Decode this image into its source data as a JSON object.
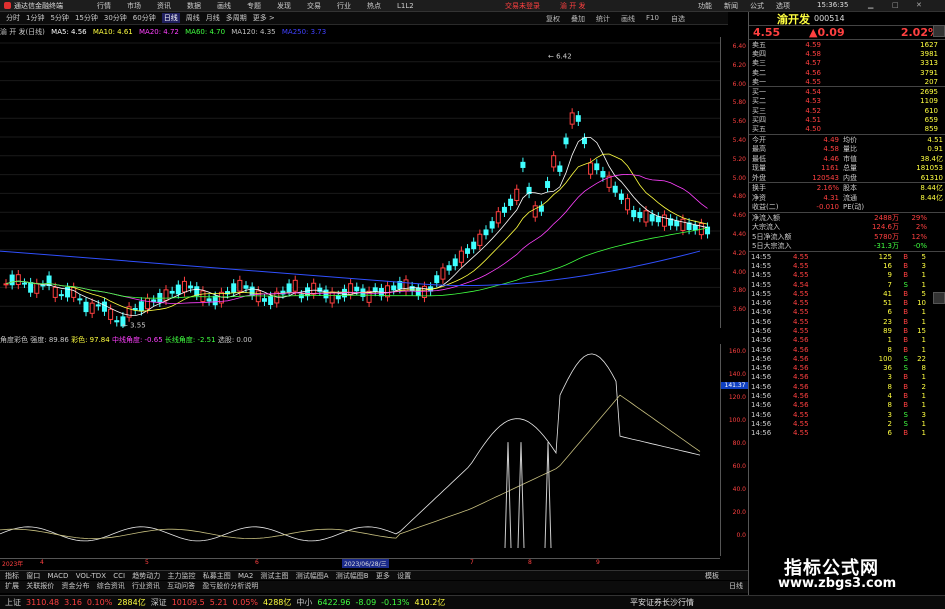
{
  "titlebar": {
    "app_name": "通达信金融终端",
    "menus": [
      "行情",
      "市场",
      "资讯",
      "数据",
      "画线",
      "专题",
      "发现",
      "交易",
      "行业",
      "热点",
      "L1L2"
    ],
    "trade_login": "交易未登录",
    "stock_name": "渝 开 发",
    "right_menus": [
      "功能",
      "新闻",
      "公式",
      "选项"
    ],
    "clock": "15:36:35"
  },
  "toolbar": {
    "periods": [
      "分时",
      "1分钟",
      "5分钟",
      "15分钟",
      "30分钟",
      "60分钟",
      "日线",
      "周线",
      "月线",
      "多周期",
      "更多 >"
    ],
    "active": "日线",
    "right_buttons": [
      "复权",
      "叠加",
      "统计",
      "画线",
      "F10",
      "自选"
    ]
  },
  "ma_legend": {
    "title": "渝 开 发(日线)",
    "items": [
      {
        "label": "MA5: 4.56",
        "color": "#ffffff"
      },
      {
        "label": "MA10: 4.61",
        "color": "#ffff40"
      },
      {
        "label": "MA20: 4.72",
        "color": "#ff40ff"
      },
      {
        "label": "MA60: 4.70",
        "color": "#40ff40"
      },
      {
        "label": "MA120: 4.35",
        "color": "#c0c0c0"
      },
      {
        "label": "MA250: 3.73",
        "color": "#4040ff"
      }
    ]
  },
  "main_chart": {
    "y_ticks": [
      "6.40",
      "6.20",
      "6.00",
      "5.80",
      "5.60",
      "5.40",
      "5.20",
      "5.00",
      "4.80",
      "4.60",
      "4.40",
      "4.20",
      "4.00",
      "3.80",
      "3.60"
    ],
    "high_label": "6.42",
    "low_label": "3.55"
  },
  "sub_chart": {
    "legend": [
      {
        "label": "角度彩色",
        "color": "#c8c8c8"
      },
      {
        "label": "强度: 89.86",
        "color": "#c8c8c8"
      },
      {
        "label": "彩色: 97.84",
        "color": "#ffff40"
      },
      {
        "label": "中线角度: -0.65",
        "color": "#ff40ff"
      },
      {
        "label": "长线角度: -2.51",
        "color": "#40ff40"
      },
      {
        "label": "选股: 0.00",
        "color": "#c8c8c8"
      }
    ],
    "y_ticks": [
      "160.0",
      "140.0",
      "120.0",
      "100.0",
      "80.0",
      "60.0",
      "40.0",
      "20.0",
      "0.0"
    ],
    "current_value": "141.37"
  },
  "date_axis": {
    "labels": [
      "2023年",
      "4",
      "5",
      "6",
      "7",
      "8",
      "9"
    ],
    "selected": "2023/06/28/三"
  },
  "bottom_tabs": [
    "指标",
    "窗口",
    "MACD",
    "VOL-TDX",
    "CCI",
    "趋势动力",
    "主力监控",
    "私募主图",
    "MA2",
    "测试主图",
    "测试幅图A",
    "测试幅图B",
    "更多",
    "设置"
  ],
  "bottom_tabs2": [
    "扩展",
    "关联报价",
    "资金分布",
    "综合资讯",
    "行业资讯",
    "互动问答",
    "盈亏股价分析说明"
  ],
  "bottom_tabs2_right": [
    "模板",
    "日线"
  ],
  "statusbar": {
    "items": [
      {
        "label": "上证",
        "color": "#c8c8c8"
      },
      {
        "label": "3110.48",
        "color": "#ff4040"
      },
      {
        "label": "3.16",
        "color": "#ff4040"
      },
      {
        "label": "0.10%",
        "color": "#ff4040"
      },
      {
        "label": "2884亿",
        "color": "#ffff40"
      },
      {
        "label": "深证",
        "color": "#c8c8c8"
      },
      {
        "label": "10109.5",
        "color": "#ff4040"
      },
      {
        "label": "5.21",
        "color": "#ff4040"
      },
      {
        "label": "0.05%",
        "color": "#ff4040"
      },
      {
        "label": "4288亿",
        "color": "#ffff40"
      },
      {
        "label": "中小",
        "color": "#c8c8c8"
      },
      {
        "label": "6422.96",
        "color": "#40ff40"
      },
      {
        "label": "-8.09",
        "color": "#40ff40"
      },
      {
        "label": "-0.13%",
        "color": "#40ff40"
      },
      {
        "label": "410.2亿",
        "color": "#ffff40"
      }
    ],
    "broker": "平安证券长沙行情"
  },
  "quote": {
    "name": "渝开发",
    "code": "000514",
    "price": "4.55",
    "change": "▲0.09",
    "pct": "2.02%",
    "asks": [
      {
        "label": "卖五",
        "price": "4.59",
        "vol": "1627"
      },
      {
        "label": "卖四",
        "price": "4.58",
        "vol": "3981"
      },
      {
        "label": "卖三",
        "price": "4.57",
        "vol": "3313"
      },
      {
        "label": "卖二",
        "price": "4.56",
        "vol": "3791"
      },
      {
        "label": "卖一",
        "price": "4.55",
        "vol": "207"
      }
    ],
    "bids": [
      {
        "label": "买一",
        "price": "4.54",
        "vol": "2695"
      },
      {
        "label": "买二",
        "price": "4.53",
        "vol": "1109"
      },
      {
        "label": "买三",
        "price": "4.52",
        "vol": "610"
      },
      {
        "label": "买四",
        "price": "4.51",
        "vol": "659"
      },
      {
        "label": "买五",
        "price": "4.50",
        "vol": "859"
      }
    ],
    "stats": [
      [
        "今开",
        "4.49",
        "均价",
        "4.51"
      ],
      [
        "最高",
        "4.58",
        "量比",
        "0.91"
      ],
      [
        "最低",
        "4.46",
        "市值",
        "38.4亿"
      ],
      [
        "现量",
        "1161",
        "总量",
        "181053"
      ],
      [
        "外盘",
        "120543",
        "内盘",
        "61310"
      ]
    ],
    "stats2": [
      [
        "换手",
        "2.16%",
        "股本",
        "8.44亿"
      ],
      [
        "净资",
        "4.31",
        "流通",
        "8.44亿"
      ],
      [
        "收益(二)",
        "-0.010",
        "PE(动)",
        ""
      ]
    ],
    "flows": [
      {
        "label": "净流入额",
        "val": "2488万",
        "pct": "29%",
        "color": "#ff4040"
      },
      {
        "label": "大宗流入",
        "val": "124.6万",
        "pct": "2%",
        "color": "#ff4040"
      },
      {
        "label": "5日净流入额",
        "val": "5780万",
        "pct": "12%",
        "color": "#ff4040"
      },
      {
        "label": "5日大宗流入",
        "val": "-31.3万",
        "pct": "-0%",
        "color": "#40ff40"
      }
    ],
    "ticks": [
      [
        "14:55",
        "4.55",
        "125",
        "B",
        "5"
      ],
      [
        "14:55",
        "4.55",
        "16",
        "B",
        "3"
      ],
      [
        "14:55",
        "4.55",
        "9",
        "B",
        "1"
      ],
      [
        "14:55",
        "4.54",
        "7",
        "S",
        "1"
      ],
      [
        "14:55",
        "4.55",
        "41",
        "B",
        "5"
      ],
      [
        "14:56",
        "4.55",
        "51",
        "B",
        "10"
      ],
      [
        "14:56",
        "4.55",
        "6",
        "B",
        "1"
      ],
      [
        "14:56",
        "4.55",
        "23",
        "B",
        "1"
      ],
      [
        "14:56",
        "4.55",
        "89",
        "B",
        "15"
      ],
      [
        "14:56",
        "4.56",
        "1",
        "B",
        "1"
      ],
      [
        "14:56",
        "4.56",
        "8",
        "B",
        "1"
      ],
      [
        "14:56",
        "4.56",
        "100",
        "S",
        "22"
      ],
      [
        "14:56",
        "4.56",
        "36",
        "S",
        "8"
      ],
      [
        "14:56",
        "4.56",
        "3",
        "B",
        "1"
      ],
      [
        "14:56",
        "4.56",
        "8",
        "B",
        "2"
      ],
      [
        "14:56",
        "4.56",
        "4",
        "B",
        "1"
      ],
      [
        "14:56",
        "4.56",
        "8",
        "B",
        "1"
      ],
      [
        "14:56",
        "4.55",
        "3",
        "S",
        "3"
      ],
      [
        "14:56",
        "4.55",
        "2",
        "S",
        "1"
      ],
      [
        "14:56",
        "4.55",
        "6",
        "B",
        "1"
      ]
    ]
  },
  "watermark": {
    "line1": "指标公式网",
    "line2": "www.zbgs3.com"
  },
  "colors": {
    "up": "#ff4040",
    "down": "#40ffff",
    "yellow": "#ffff40",
    "green": "#40ff40"
  }
}
